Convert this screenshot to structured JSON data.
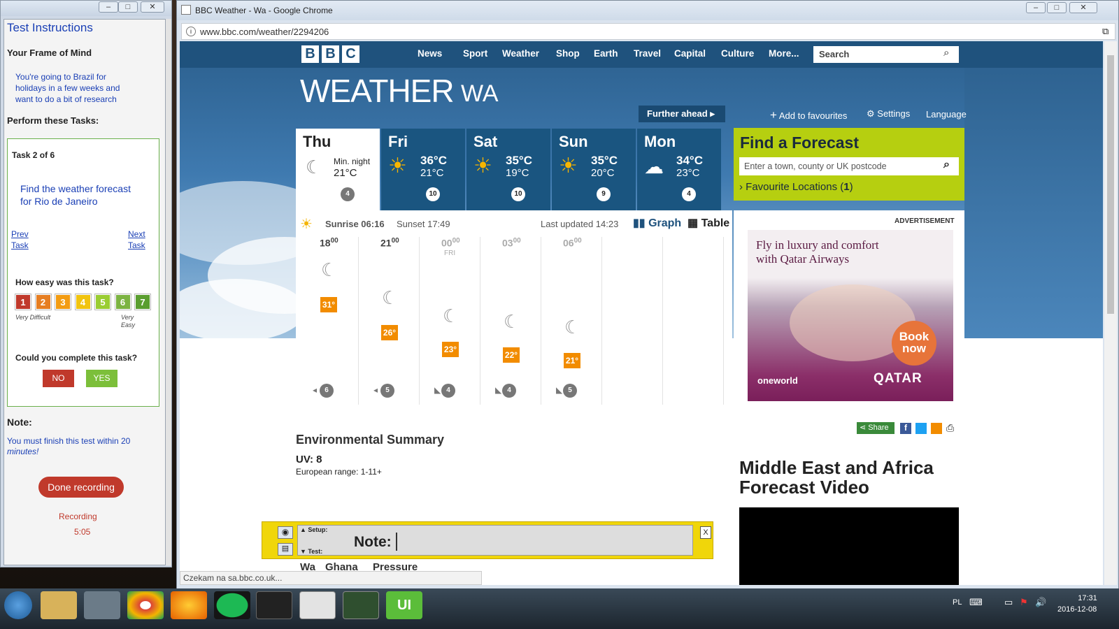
{
  "test": {
    "title": "Test Instructions",
    "frame_heading": "Your Frame of Mind",
    "frame_text": "You're going to Brazil for holidays in a few weeks and want to do a bit of research",
    "tasks_heading": "Perform these Tasks:",
    "task_counter": "Task 2 of 6",
    "task_text": "Find the weather forecast for Rio de Janeiro",
    "prev_label": "Prev Task",
    "next_label": "Next Task",
    "ease_question": "How easy was this task?",
    "ratings": [
      "1",
      "2",
      "3",
      "4",
      "5",
      "6",
      "7"
    ],
    "rating_colors": [
      "#c0392b",
      "#e67e22",
      "#f39c12",
      "#f1c40f",
      "#9acd32",
      "#7cb342",
      "#5a9e2f"
    ],
    "very_difficult": "Very Difficult",
    "very_easy": "Very Easy",
    "complete_question": "Could you complete this task?",
    "no_label": "NO",
    "yes_label": "YES",
    "note_heading": "Note:",
    "note_text": "You must finish this test within 20",
    "note_text2": "minutes!",
    "done_label": "Done recording",
    "recording_label": "Recording",
    "recording_time": "5:05"
  },
  "browser": {
    "window_title": "BBC Weather - Wa - Google Chrome",
    "url": "www.bbc.com/weather/2294206",
    "status": "Czekam na sa.bbc.co.uk..."
  },
  "bbc": {
    "logo_letters": [
      "B",
      "B",
      "C"
    ],
    "nav": [
      "News",
      "Sport",
      "Weather",
      "Shop",
      "Earth",
      "Travel",
      "Capital",
      "Culture",
      "More..."
    ],
    "search_placeholder": "Search",
    "weather_title": "WEATHER",
    "location": "WA",
    "further_ahead": "Further ahead",
    "add_favourites": "Add to favourites",
    "settings": "Settings",
    "language": "Language",
    "days": [
      {
        "name": "Thu",
        "line1": "Min. night",
        "line2": "21°C",
        "wind": "4"
      },
      {
        "name": "Fri",
        "max": "36°C",
        "min": "21°C",
        "wind": "10"
      },
      {
        "name": "Sat",
        "max": "35°C",
        "min": "19°C",
        "wind": "10"
      },
      {
        "name": "Sun",
        "max": "35°C",
        "min": "20°C",
        "wind": "9"
      },
      {
        "name": "Mon",
        "max": "34°C",
        "min": "23°C",
        "wind": "4"
      }
    ],
    "find_forecast": "Find a Forecast",
    "find_placeholder": "Enter a town, county or UK postcode",
    "favourite_locations": "Favourite Locations",
    "favourite_count": "1",
    "sunrise_label": "Sunrise 06:16",
    "sunset_label": "Sunset 17:49",
    "last_updated": "Last updated 14:23",
    "graph_label": "Graph",
    "table_label": "Table",
    "hours": [
      {
        "h": "18",
        "m": "00",
        "sub": "",
        "temp": "31°",
        "wind": "6"
      },
      {
        "h": "21",
        "m": "00",
        "sub": "",
        "temp": "26°",
        "wind": "5"
      },
      {
        "h": "00",
        "m": "00",
        "sub": "FRI",
        "temp": "23°",
        "wind": "4"
      },
      {
        "h": "03",
        "m": "00",
        "sub": "",
        "temp": "22°",
        "wind": "4"
      },
      {
        "h": "06",
        "m": "00",
        "sub": "",
        "temp": "21°",
        "wind": "5"
      }
    ],
    "advertisement": "ADVERTISEMENT",
    "ad_text1": "Fly in luxury and comfort",
    "ad_text2": "with Qatar Airways",
    "ad_book1": "Book",
    "ad_book2": "now",
    "ad_oneworld": "oneworld",
    "ad_brand": "QATAR",
    "share_label": "Share",
    "env_title": "Environmental Summary",
    "uv": "UV: 8",
    "uv_range": "European range: 1-11+",
    "video_title1": "Middle East and Africa",
    "video_title2": "Forecast Video",
    "tabs_bottom": [
      "Wa",
      "Ghana",
      "Pressure"
    ]
  },
  "notebar": {
    "setup": "▲ Setup:",
    "note": "Note:",
    "test": "▼ Test:",
    "close": "X"
  },
  "taskbar": {
    "lang": "PL",
    "time": "17:31",
    "date": "2016-12-08"
  }
}
